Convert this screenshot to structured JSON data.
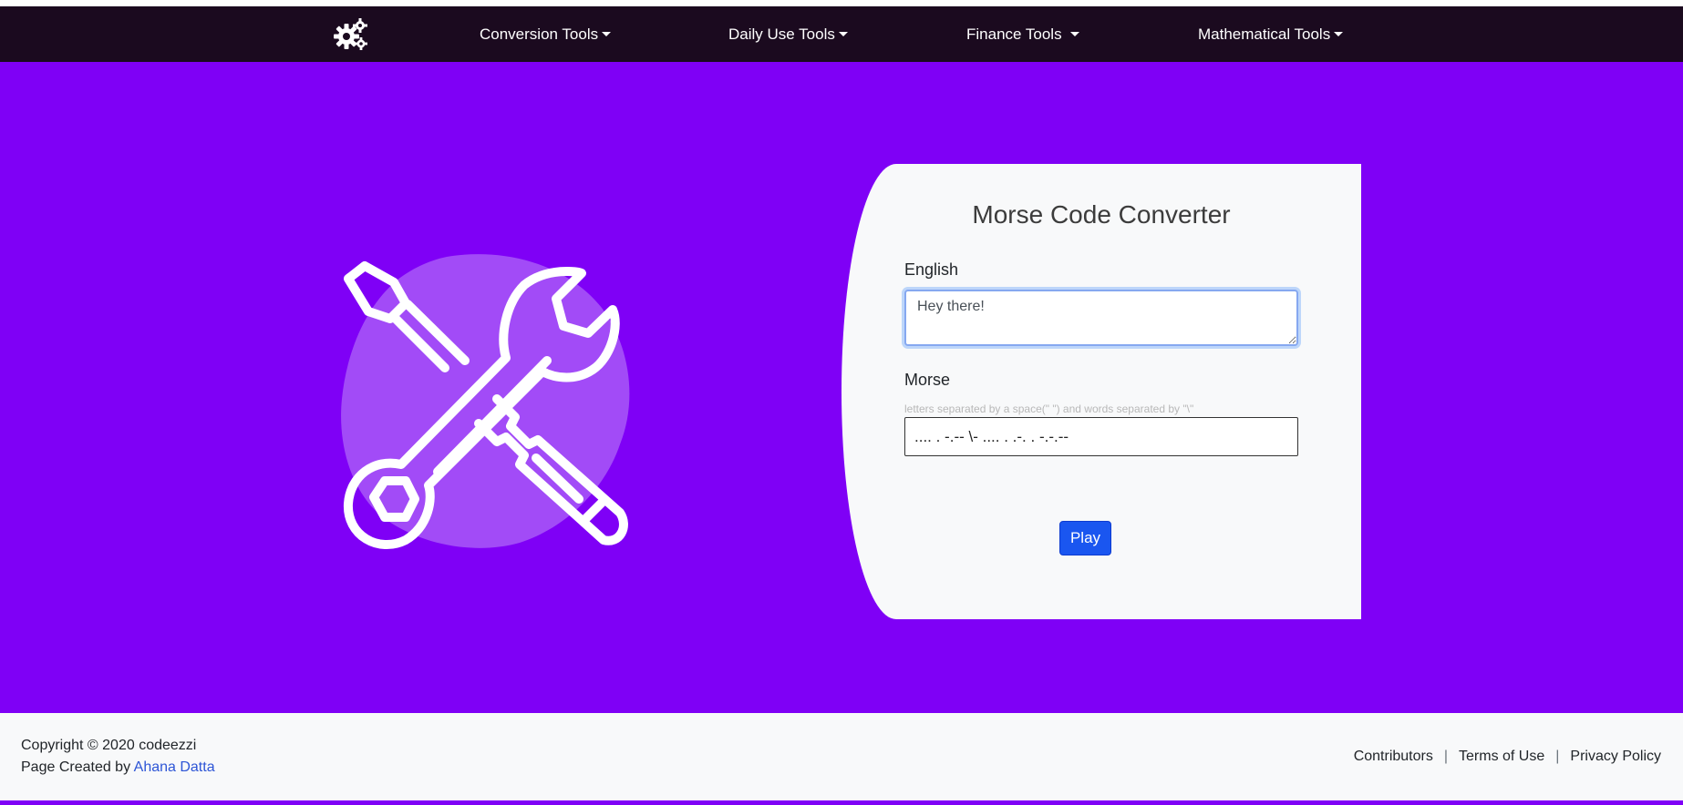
{
  "nav": {
    "logo_icon": "gears-icon",
    "items": [
      {
        "label": "Conversion Tools"
      },
      {
        "label": "Daily Use Tools"
      },
      {
        "label": "Finance Tools"
      },
      {
        "label": "Mathematical Tools"
      }
    ]
  },
  "hero": {
    "illustration_icon": "tools-icon",
    "background_color": "#7f00f6"
  },
  "converter": {
    "title": "Morse Code Converter",
    "english_label": "English",
    "english_value": "Hey there!",
    "morse_label": "Morse",
    "morse_hint": "letters separated by a space(\" \") and words separated by \"\\\"",
    "morse_value": ".... . -.-- \\- .... . .-. . -.-.--",
    "play_label": "Play"
  },
  "footer": {
    "copyright": "Copyright © 2020 codeezzi",
    "created_by_prefix": "Page Created by ",
    "author": "Ahana Datta",
    "links": [
      "Contributors",
      "Terms of Use",
      "Privacy Policy"
    ],
    "separator": "|"
  }
}
